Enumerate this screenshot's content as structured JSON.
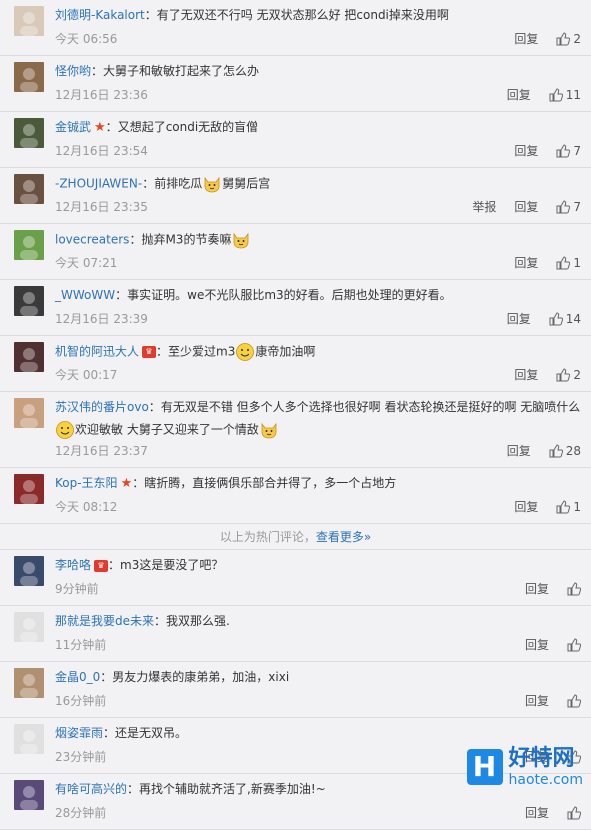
{
  "hot_comments": [
    {
      "name": "刘德明-Kakalort",
      "text": "有了无双还不行吗 无双状态那么好 把condi掉来没用啊",
      "time": "今天 06:56",
      "reply": "回复",
      "likes": "2",
      "avatar_color": "#d8c9b8"
    },
    {
      "name": "怪你哟",
      "text": "大舅子和敏敏打起来了怎么办",
      "time": "12月16日 23:36",
      "reply": "回复",
      "likes": "11",
      "avatar_color": "#8a6a4a"
    },
    {
      "name": "金铖武",
      "text": "又想起了condi无敌的盲僧",
      "time": "12月16日 23:54",
      "reply": "回复",
      "likes": "7",
      "avatar_color": "#4a5a3a",
      "vip": true
    },
    {
      "name": "-ZHOUJIAWEN-",
      "text": "前排吃瓜",
      "text2": "舅舅后宫",
      "time": "12月16日 23:35",
      "report": "举报",
      "reply": "回复",
      "likes": "7",
      "avatar_color": "#6a5040"
    },
    {
      "name": "lovecreaters",
      "text": "抛弃M3的节奏嘛",
      "time": "今天 07:21",
      "reply": "回复",
      "likes": "1",
      "avatar_color": "#6aa04a"
    },
    {
      "name": "_WWoWW",
      "text": "事实证明。we不光队服比m3的好看。后期也处理的更好看。",
      "time": "12月16日 23:39",
      "reply": "回复",
      "likes": "14",
      "avatar_color": "#3a3a3a"
    },
    {
      "name": "机智的阿迅大人",
      "text": "至少爱过m3",
      "text2": "康帝加油啊",
      "time": "今天 00:17",
      "reply": "回复",
      "likes": "2",
      "avatar_color": "#503030",
      "crown": true
    },
    {
      "name": "苏汉伟的番片ovo",
      "text": "有无双是不错 但多个人多个选择也很好啊 看状态轮换还是挺好的啊 无脑喷什么",
      "line2a": "欢迎敏敏 大舅子又迎来了一个情敌",
      "time": "12月16日 23:37",
      "reply": "回复",
      "likes": "28",
      "avatar_color": "#c8a080"
    },
    {
      "name": "Kop-王东阳",
      "text": "瞎折腾，直接俩俱乐部合并得了，多一个占地方",
      "time": "今天 08:12",
      "reply": "回复",
      "likes": "1",
      "avatar_color": "#8a2a2a",
      "vip": true
    }
  ],
  "divider": {
    "prefix": "以上为热门评论，",
    "more": "查看更多»"
  },
  "new_comments": [
    {
      "name": "李哈咯",
      "text": "m3这是要没了吧？",
      "time": "9分钟前",
      "reply": "回复",
      "avatar_color": "#3a4a6a",
      "crown": true
    },
    {
      "name": "那就是我要de未来",
      "text": "我双那么强.",
      "time": "11分钟前",
      "reply": "回复",
      "avatar_color": "#e0e0e0"
    },
    {
      "name": "金晶0_0",
      "text": "男友力爆表的康弟弟，加油，xixi",
      "time": "16分钟前",
      "reply": "回复",
      "avatar_color": "#b09070"
    },
    {
      "name": "烟姿霏雨",
      "text": "还是无双吊。",
      "time": "23分钟前",
      "reply": "回复",
      "avatar_color": "#e0e0e0"
    },
    {
      "name": "有啥可高兴的",
      "text": "再找个辅助就齐活了,新赛季加油!~",
      "time": "28分钟前",
      "reply": "回复",
      "avatar_color": "#5a4a7a"
    }
  ],
  "colon": "：",
  "watermark": {
    "logo": "H",
    "cn": "好特网",
    "url": "haote.com"
  }
}
